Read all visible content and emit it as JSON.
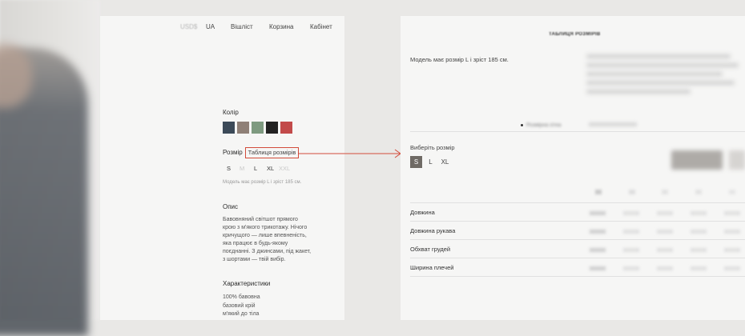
{
  "nav": {
    "currency": "USD$",
    "language": "UA",
    "wishlist": "Вішліст",
    "cart": "Корзина",
    "account": "Кабінет"
  },
  "product": {
    "color_label": "Колір",
    "colors": [
      "#3c4a58",
      "#8f8077",
      "#7e9a80",
      "#222222",
      "#c24a4a"
    ],
    "size_label": "Розмір",
    "size_guide_link": "Таблиця розмірів",
    "sizes": [
      {
        "label": "S",
        "available": true
      },
      {
        "label": "M",
        "available": false
      },
      {
        "label": "L",
        "available": true
      },
      {
        "label": "XL",
        "available": true
      },
      {
        "label": "XXL",
        "available": false
      }
    ],
    "model_note": "Модель має розмір L і зріст 185 см.",
    "description_title": "Опис",
    "description_lines": [
      "Бавовняний світшот прямого",
      "крою з м'якого трикотажу. Нічого",
      "кричущого — лише впевненість,",
      "яка працює в будь-якому",
      "поєднанні. З джинсами, під жакет,",
      "з шортами — твій вибір."
    ],
    "characteristics_title": "Характеристики",
    "characteristics": [
      "100% бавовна",
      "базовий крій",
      "м'який до тіла"
    ]
  },
  "size_modal": {
    "title": "ТАБЛИЦЯ РОЗМІРІВ",
    "model_note": "Модель має розмір L і зріст 185 см.",
    "bullet_label": "Розмірна сітка",
    "choose_size_label": "Виберіть розмір",
    "sizes": [
      "S",
      "L",
      "XL"
    ],
    "selected_size": "S",
    "rows": [
      "Довжина",
      "Довжина рукава",
      "Обхват грудей",
      "Ширина плечей"
    ]
  },
  "colors": {
    "accent_outline": "#d24b3a",
    "selected_size_bg": "#6f6a65"
  }
}
